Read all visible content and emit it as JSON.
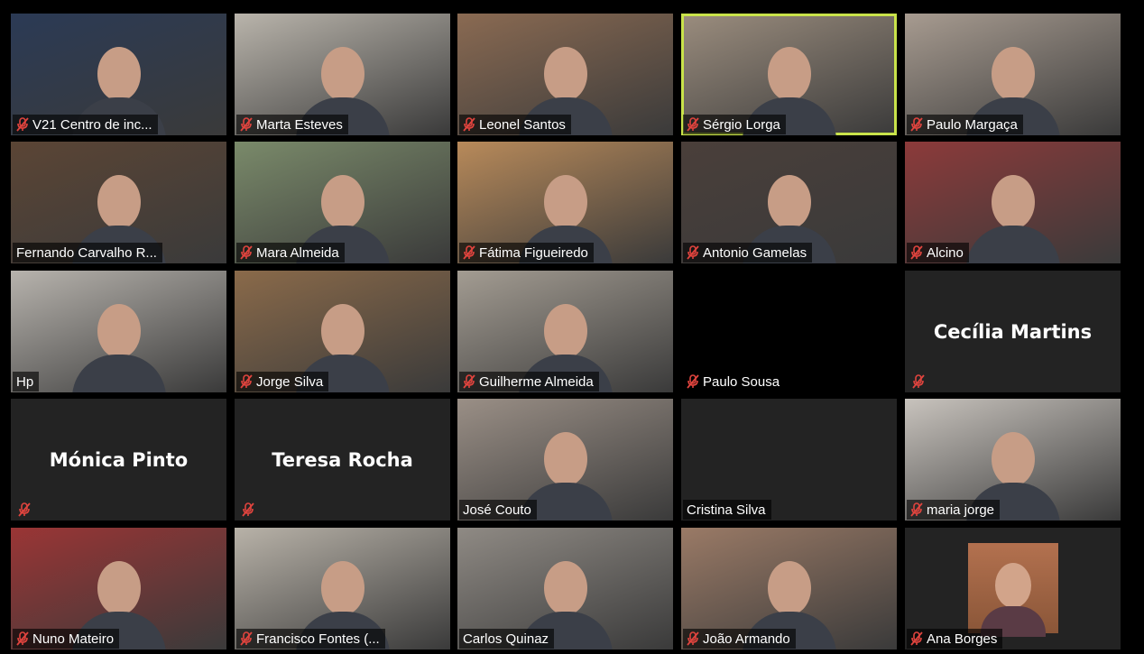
{
  "meeting": {
    "participants": [
      {
        "name": "V21 Centro de inc...",
        "muted": true,
        "mode": "video",
        "active": false,
        "bg": "#2b3a55"
      },
      {
        "name": "Marta Esteves",
        "muted": true,
        "mode": "video",
        "active": false,
        "bg": "#b9b4ab"
      },
      {
        "name": "Leonel Santos",
        "muted": true,
        "mode": "video",
        "active": false,
        "bg": "#8a6a52"
      },
      {
        "name": "Sérgio Lorga",
        "muted": true,
        "mode": "video",
        "active": true,
        "bg": "#9b8d7e"
      },
      {
        "name": "Paulo Margaça",
        "muted": true,
        "mode": "video",
        "active": false,
        "bg": "#a79b90"
      },
      {
        "name": "Fernando Carvalho R...",
        "muted": false,
        "mode": "video",
        "active": false,
        "bg": "#5b4535"
      },
      {
        "name": "Mara Almeida",
        "muted": true,
        "mode": "video",
        "active": false,
        "bg": "#7a8a6a"
      },
      {
        "name": "Fátima Figueiredo",
        "muted": true,
        "mode": "video",
        "active": false,
        "bg": "#b88a5a"
      },
      {
        "name": "Antonio Gamelas",
        "muted": true,
        "mode": "video",
        "active": false,
        "bg": "#4a3f3a"
      },
      {
        "name": "Alcino",
        "muted": true,
        "mode": "video",
        "active": false,
        "bg": "#8c3a3a"
      },
      {
        "name": "Hp",
        "muted": false,
        "mode": "video",
        "active": false,
        "bg": "#b7b3ad"
      },
      {
        "name": "Jorge Silva",
        "muted": true,
        "mode": "video",
        "active": false,
        "bg": "#8a6a4a"
      },
      {
        "name": "Guilherme Almeida",
        "muted": true,
        "mode": "video",
        "active": false,
        "bg": "#a39c92"
      },
      {
        "name": "Paulo Sousa",
        "muted": true,
        "mode": "blank",
        "active": false,
        "bg": "#000000"
      },
      {
        "name": "",
        "display_name": "Cecília Martins",
        "muted": true,
        "mode": "name",
        "active": false,
        "bg": "#232323"
      },
      {
        "name": "",
        "display_name": "Mónica Pinto",
        "muted": true,
        "mode": "name",
        "active": false,
        "bg": "#232323"
      },
      {
        "name": "",
        "display_name": "Teresa Rocha",
        "muted": true,
        "mode": "name",
        "active": false,
        "bg": "#232323"
      },
      {
        "name": "José Couto",
        "muted": false,
        "mode": "video",
        "active": false,
        "bg": "#9a8f86"
      },
      {
        "name": "Cristina Silva",
        "muted": false,
        "mode": "blank",
        "active": false,
        "bg": "#232323"
      },
      {
        "name": "maria jorge",
        "muted": true,
        "mode": "video",
        "active": false,
        "bg": "#c8c3bd"
      },
      {
        "name": "Nuno Mateiro",
        "muted": true,
        "mode": "video",
        "active": false,
        "bg": "#9a3535"
      },
      {
        "name": "Francisco Fontes (...",
        "muted": true,
        "mode": "video",
        "active": false,
        "bg": "#b8b2a8"
      },
      {
        "name": "Carlos Quinaz",
        "muted": false,
        "mode": "video",
        "active": false,
        "bg": "#8f8a84"
      },
      {
        "name": "João Armando",
        "muted": true,
        "mode": "video",
        "active": false,
        "bg": "#9a7a66"
      },
      {
        "name": "Ana Borges",
        "muted": true,
        "mode": "photo",
        "active": false,
        "bg": "#232323"
      }
    ]
  }
}
